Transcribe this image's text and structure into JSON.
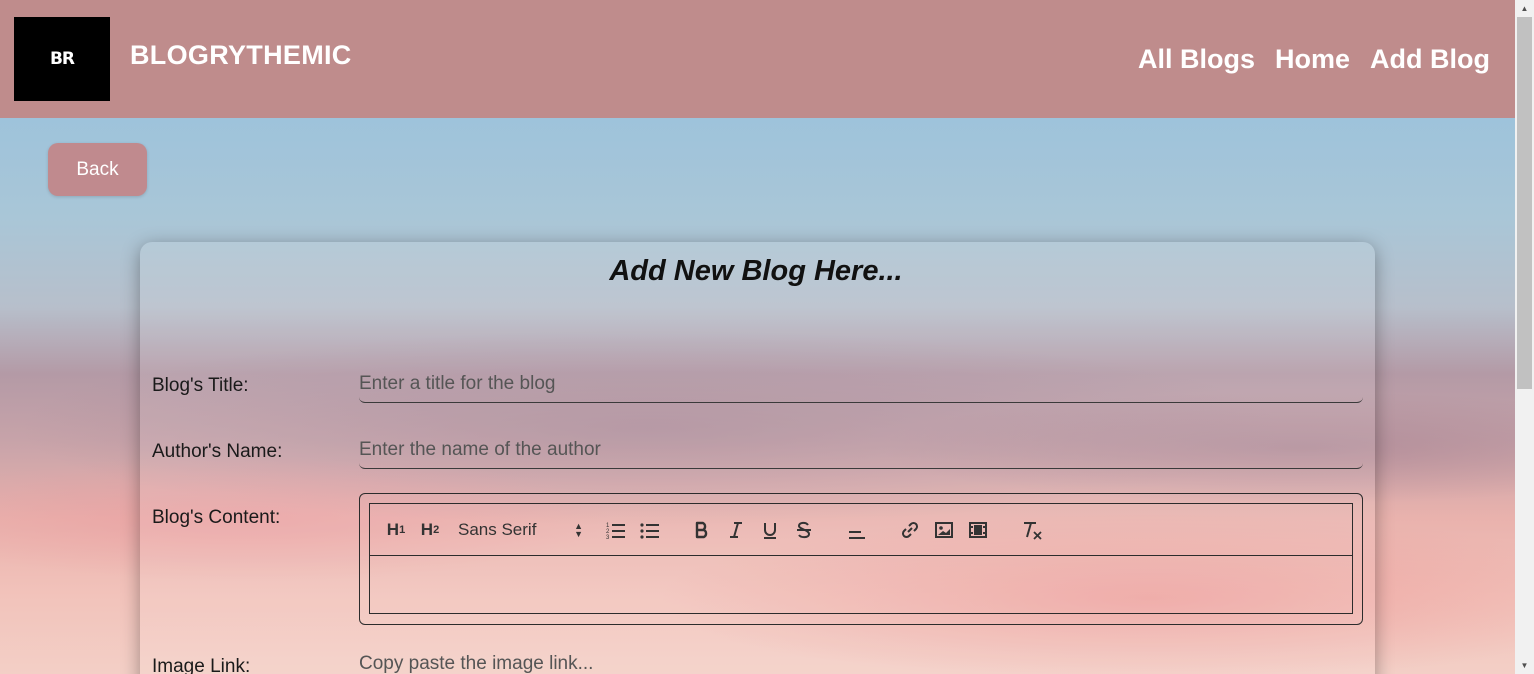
{
  "header": {
    "logo_text": "BR",
    "brand": "BLOGRYTHEMIC",
    "nav": [
      "All Blogs",
      "Home",
      "Add Blog"
    ]
  },
  "back_label": "Back",
  "form": {
    "title": "Add New Blog Here...",
    "fields": {
      "title": {
        "label": "Blog's Title:",
        "placeholder": "Enter a title for the blog"
      },
      "author": {
        "label": "Author's Name:",
        "placeholder": "Enter the name of the author"
      },
      "content": {
        "label": "Blog's Content:"
      },
      "image": {
        "label": "Image Link:",
        "placeholder": "Copy paste the image link..."
      }
    },
    "toolbar": {
      "h1": "H",
      "h1_sub": "1",
      "h2": "H",
      "h2_sub": "2",
      "font": "Sans Serif",
      "icons": [
        "ordered-list-icon",
        "bullet-list-icon",
        "bold-icon",
        "italic-icon",
        "underline-icon",
        "strike-icon",
        "align-icon",
        "link-icon",
        "image-icon",
        "video-icon",
        "clear-format-icon"
      ]
    }
  }
}
